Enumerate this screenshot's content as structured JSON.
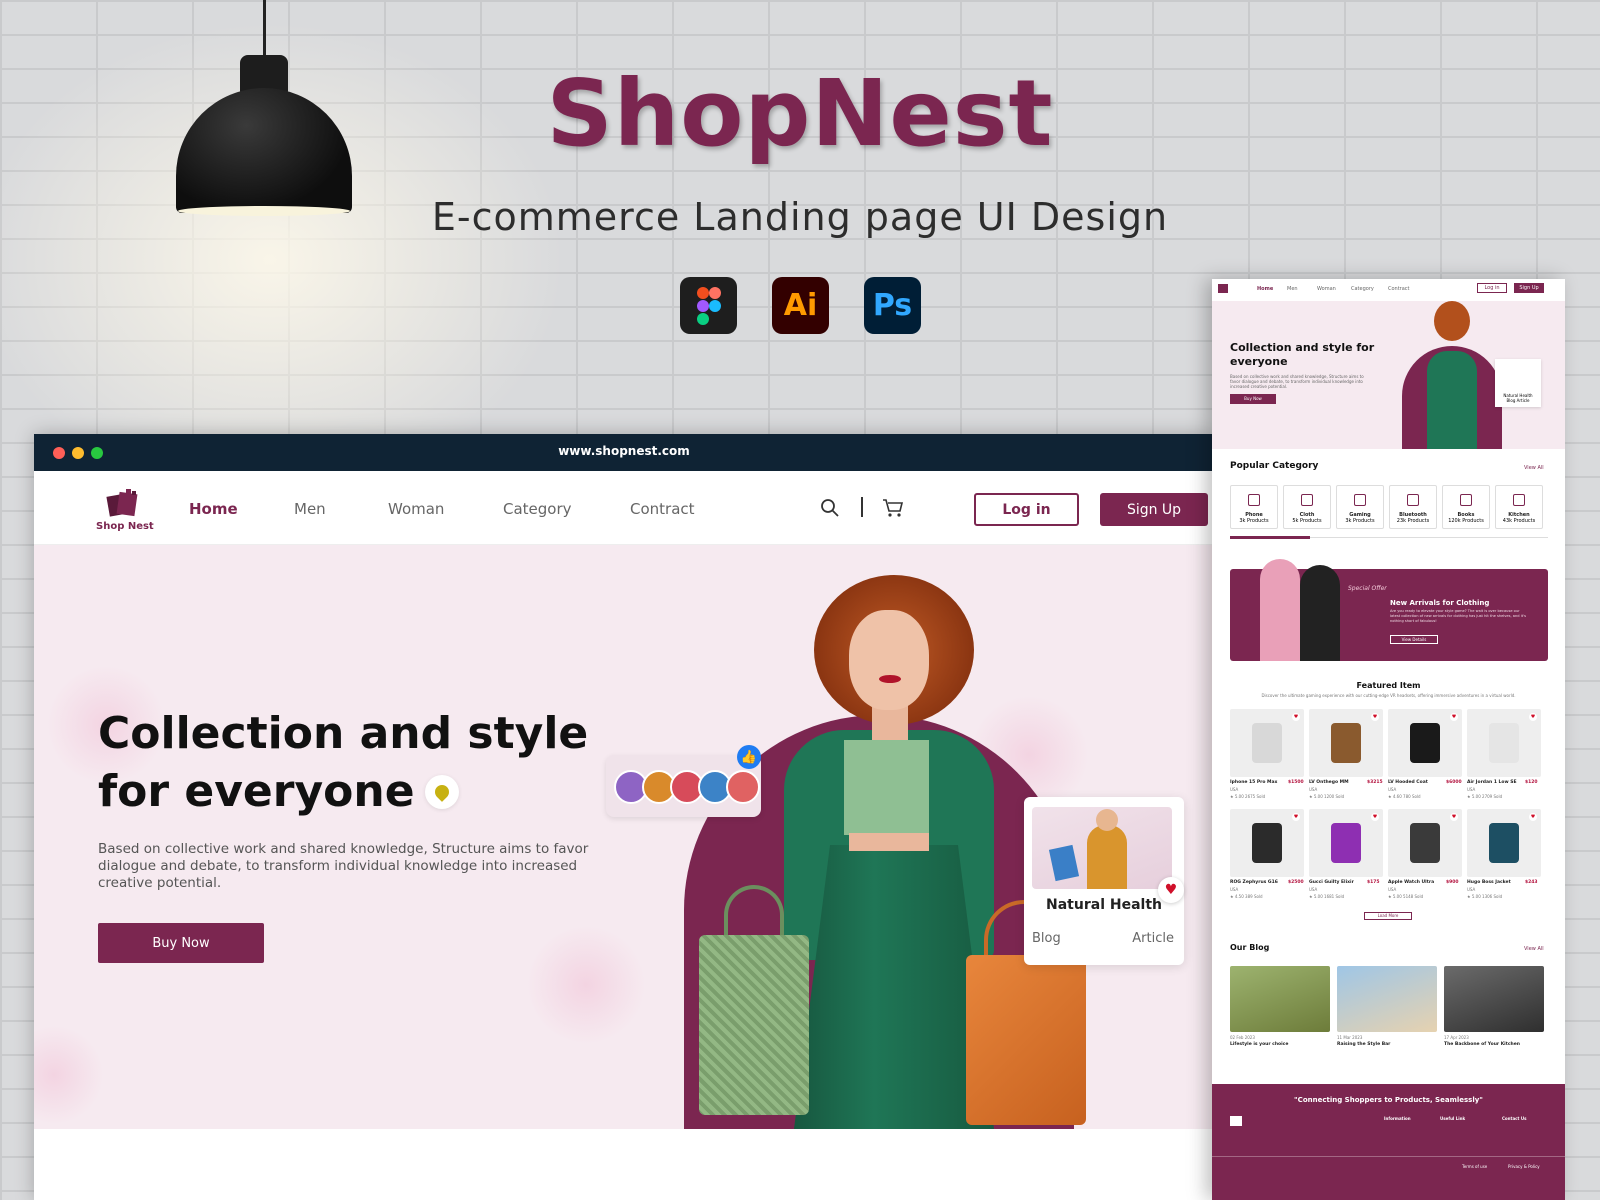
{
  "brand": "ShopNest",
  "subtitle": "E-commerce Landing page UI Design",
  "tools": [
    "figma-icon",
    "Ai",
    "Ps"
  ],
  "colors": {
    "primary": "#7b2650",
    "hero_bg": "#f6eaf0",
    "titlebar": "#0f2334"
  },
  "browser": {
    "url": "www.shopnest.com"
  },
  "nav": {
    "logo": "Shop Nest",
    "links": [
      "Home",
      "Men",
      "Woman",
      "Category",
      "Contract"
    ],
    "login": "Log in",
    "signup": "Sign Up"
  },
  "hero": {
    "title_line1": "Collection and style",
    "title_line2": "for everyone",
    "description": "Based on collective work and shared knowledge, Structure aims to favor dialogue and debate, to transform individual knowledge into increased creative potential.",
    "button": "Buy Now",
    "card": {
      "title": "Natural Health",
      "left": "Blog",
      "right": "Article"
    }
  },
  "preview": {
    "nav_links": [
      "Home",
      "Men",
      "Woman",
      "Category",
      "Contract"
    ],
    "login": "Log in",
    "signup": "Sign Up",
    "hero_title": "Collection and style for everyone",
    "hero_desc": "Based on collective work and shared knowledge, Structure aims to favor dialogue and debate, to transform individual knowledge into increased creative potential.",
    "buy": "Buy Now",
    "card_title": "Natural Health",
    "card_left": "Blog",
    "card_right": "Article",
    "popular_category": "Popular Category",
    "view_all": "View All",
    "categories": [
      {
        "name": "Phone",
        "count": "3k Products"
      },
      {
        "name": "Cloth",
        "count": "5k Products"
      },
      {
        "name": "Gaming",
        "count": "3k Products"
      },
      {
        "name": "Bluetooth",
        "count": "23k Products"
      },
      {
        "name": "Books",
        "count": "120k Products"
      },
      {
        "name": "Kitchen",
        "count": "43k Products"
      }
    ],
    "offer_tag": "Special Offer",
    "offer_title": "New Arrivals for Clothing",
    "offer_desc": "Are you ready to elevate your style game? The wait is over because our latest collection of new arrivals for clothing has just hit the shelves, and it's nothing short of fabulous!",
    "offer_btn": "View Details",
    "featured": "Featured Item",
    "featured_desc": "Discover the ultimate gaming experience with our cutting-edge VR headsets, offering immersive adventures in a virtual world.",
    "products": [
      {
        "name": "Iphone 15 Pro Max",
        "price": "$1500",
        "rating": "5.00",
        "sold": "2675 Sold"
      },
      {
        "name": "LV Onthego MM",
        "price": "$3215",
        "rating": "5.00",
        "sold": "1200 Sold"
      },
      {
        "name": "LV Hooded Coat",
        "price": "$6000",
        "rating": "4.60",
        "sold": "780 Sold"
      },
      {
        "name": "Air Jordan 1 Low SE",
        "price": "$120",
        "rating": "5.00",
        "sold": "2709 Sold"
      },
      {
        "name": "ROG Zephyrus G16",
        "price": "$2500",
        "rating": "4.50",
        "sold": "389 Sold"
      },
      {
        "name": "Gucci Guilty Elixir",
        "price": "$175",
        "rating": "5.00",
        "sold": "1681 Sold"
      },
      {
        "name": "Apple Watch Ultra",
        "price": "$900",
        "rating": "5.00",
        "sold": "5148 Sold"
      },
      {
        "name": "Hugo Boss Jacket",
        "price": "$243",
        "rating": "5.00",
        "sold": "1306 Sold"
      }
    ],
    "country": "USA",
    "load_more": "Load More",
    "our_blog": "Our Blog",
    "blogs": [
      {
        "date": "02 Feb 2023",
        "title": "Lifestyle is your choice"
      },
      {
        "date": "11 Mar 2023",
        "title": "Raising the Style Bar"
      },
      {
        "date": "17 Apr 2023",
        "title": "The Backbone of Your Kitchen"
      }
    ],
    "footer_quote": "\"Connecting Shoppers to Products, Seamlessly\"",
    "footer_cols": [
      "Information",
      "Useful Link",
      "Contact Us"
    ],
    "footer_links": [
      "Terms of use",
      "Privacy & Policy"
    ]
  }
}
